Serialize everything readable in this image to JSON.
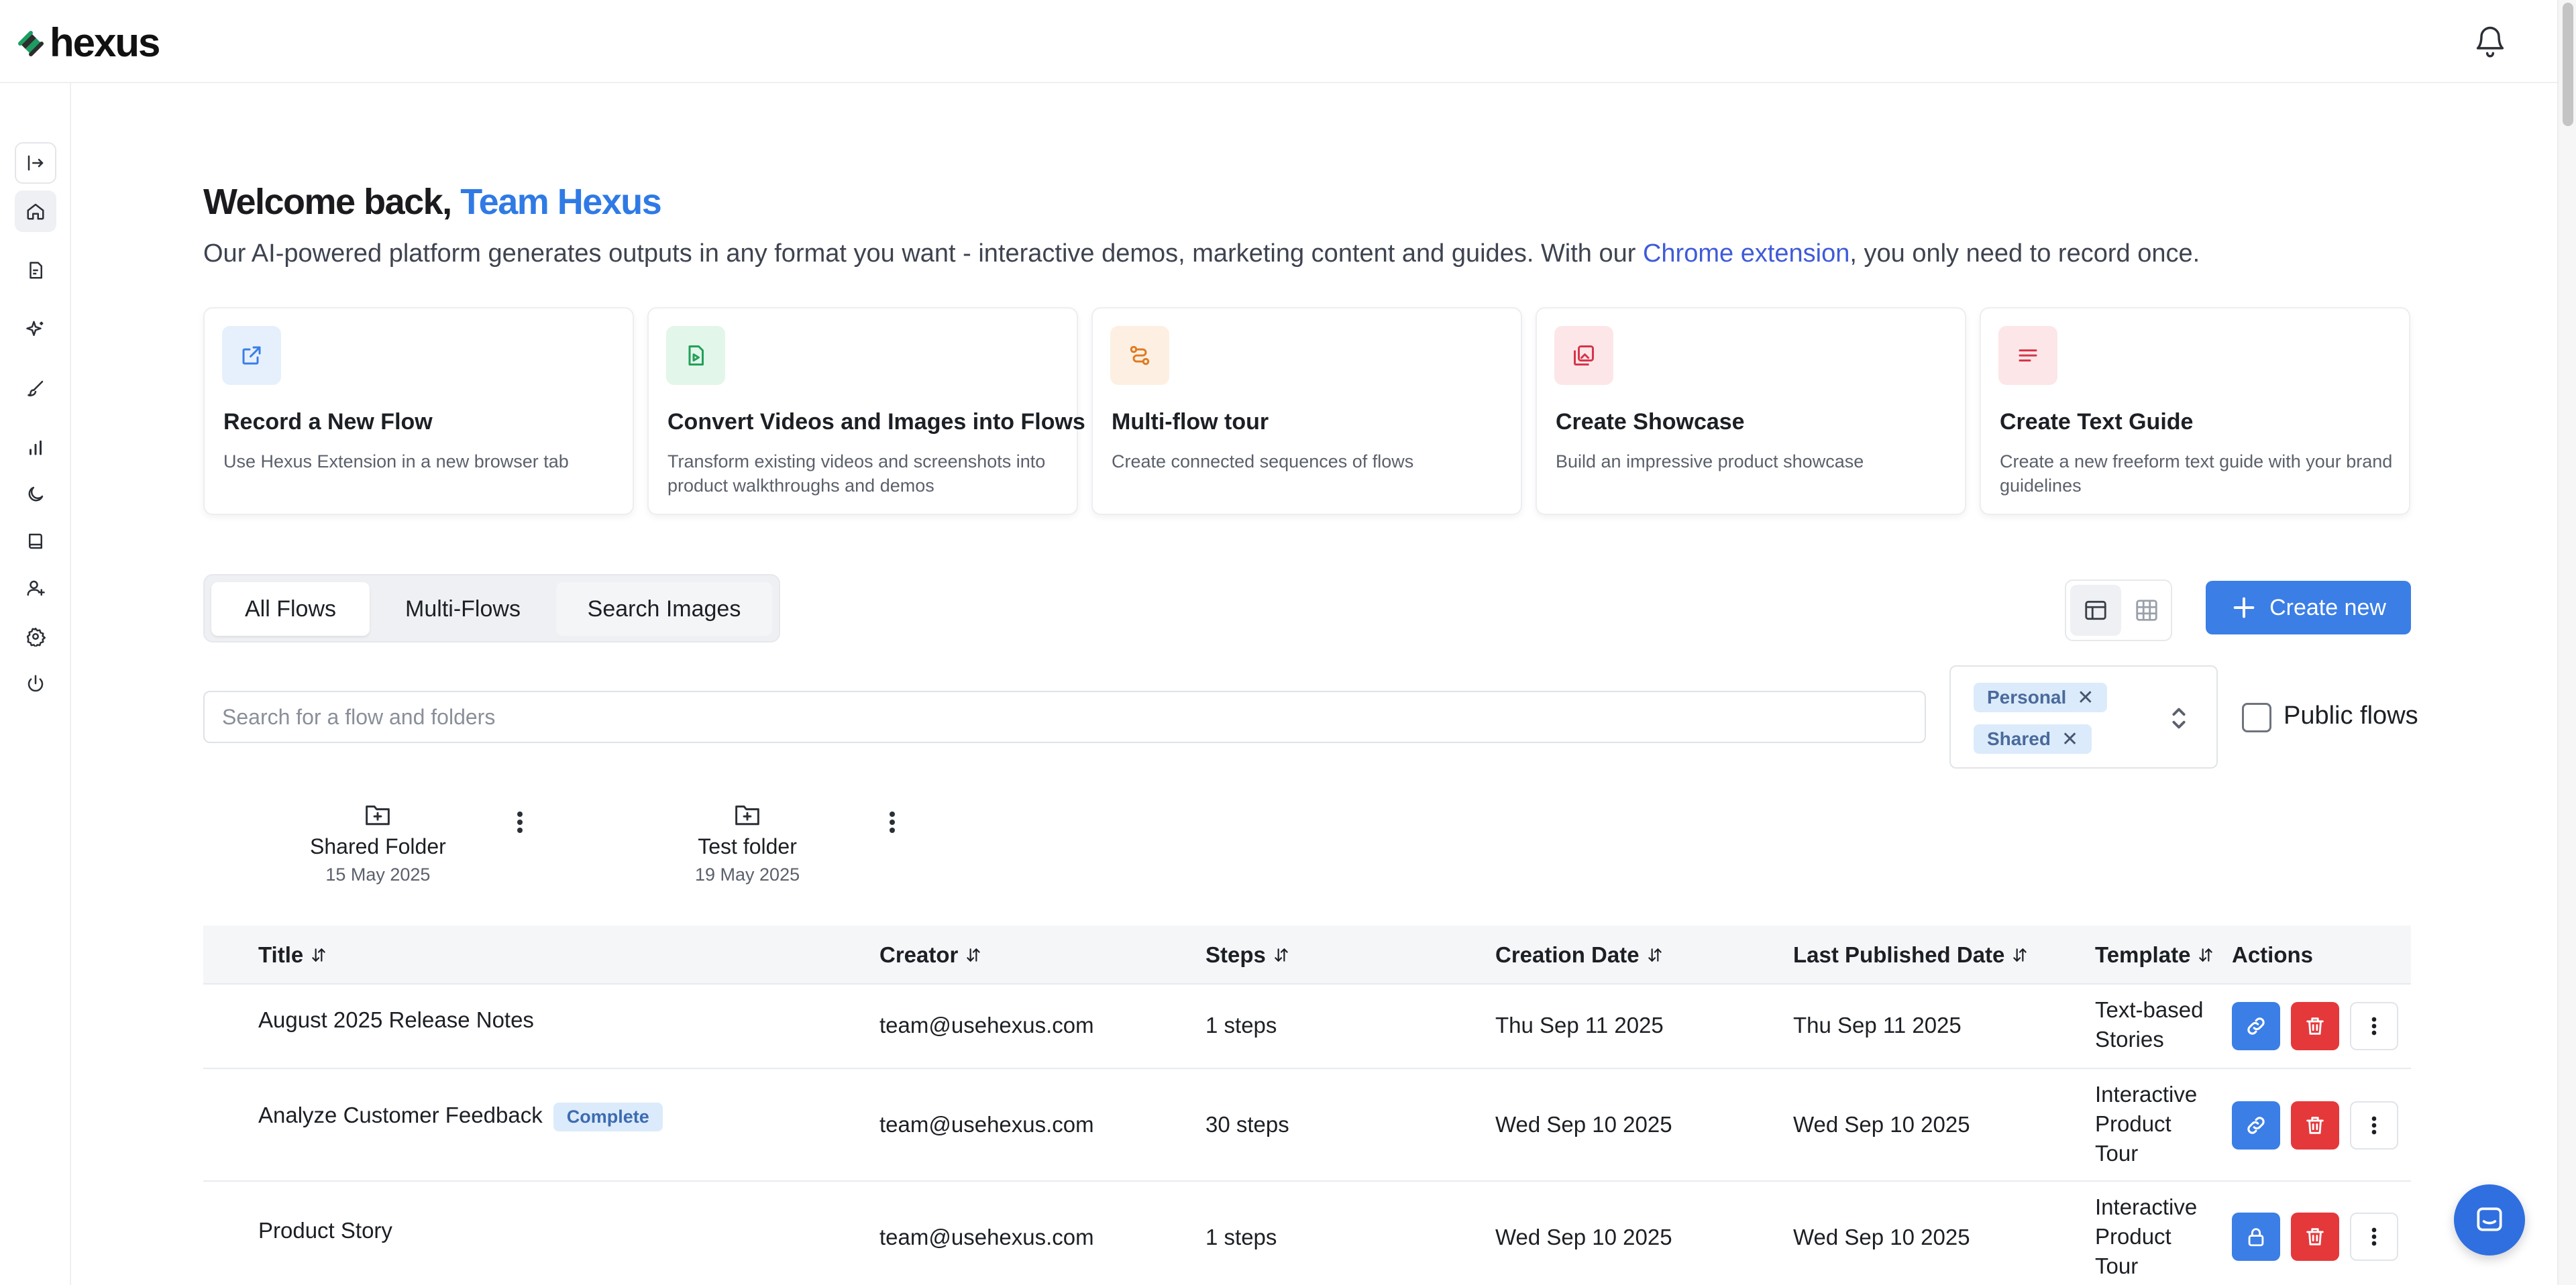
{
  "app": {
    "logo_text": "hexus"
  },
  "welcome": {
    "prefix": "Welcome back, ",
    "team": "Team Hexus",
    "subtitle_before": "Our AI-powered platform generates outputs in any format you want - interactive demos, marketing content and guides. With our ",
    "subtitle_link": "Chrome extension",
    "subtitle_after": ", you only need to record once."
  },
  "sidebar": {
    "items": [
      {
        "icon": "expand-sidebar-icon"
      },
      {
        "icon": "home-icon"
      },
      {
        "icon": "document-icon"
      },
      {
        "icon": "sparkle-icon"
      },
      {
        "icon": "brush-icon"
      },
      {
        "icon": "analytics-icon"
      },
      {
        "icon": "moon-icon"
      },
      {
        "icon": "book-icon"
      },
      {
        "icon": "add-user-icon"
      },
      {
        "icon": "settings-icon"
      },
      {
        "icon": "power-icon"
      }
    ]
  },
  "cards": [
    {
      "title": "Record a New Flow",
      "desc": "Use Hexus Extension in a new browser tab",
      "icon": "external-link-icon",
      "color": "#3b7ee6",
      "bg": "#e6f0fd"
    },
    {
      "title": "Convert Videos and Images into Flows",
      "desc": "Transform existing videos and screenshots into product walkthroughs and demos",
      "icon": "file-video-icon",
      "color": "#22a05a",
      "bg": "#e3f6ea"
    },
    {
      "title": "Multi-flow tour",
      "desc": "Create connected sequences of flows",
      "icon": "route-icon",
      "color": "#e07b24",
      "bg": "#fdf0e2"
    },
    {
      "title": "Create Showcase",
      "desc": "Build an impressive product showcase",
      "icon": "gallery-icon",
      "color": "#d6364a",
      "bg": "#fde6e8"
    },
    {
      "title": "Create Text Guide",
      "desc": "Create a new freeform text guide with your brand guidelines",
      "icon": "text-lines-icon",
      "color": "#d6364a",
      "bg": "#fde6e8"
    }
  ],
  "tabs": [
    "All Flows",
    "Multi-Flows",
    "Search Images"
  ],
  "toolbar": {
    "create_label": "Create new"
  },
  "search": {
    "placeholder": "Search for a flow and folders"
  },
  "filter": {
    "chips": [
      "Personal",
      "Shared"
    ]
  },
  "public_flows_label": "Public flows",
  "folders": [
    {
      "name": "Shared Folder",
      "date": "15 May 2025"
    },
    {
      "name": "Test folder",
      "date": "19 May 2025"
    }
  ],
  "table": {
    "headers": [
      "Title",
      "Creator",
      "Steps",
      "Creation Date",
      "Last Published Date",
      "Template",
      "Actions"
    ],
    "rows": [
      {
        "title": "August 2025 Release Notes",
        "badge": "",
        "creator": "team@usehexus.com",
        "steps": "1 steps",
        "created": "Thu Sep 11 2025",
        "published": "Thu Sep 11 2025",
        "template": "Text-based Stories",
        "first_action_icon": "link-icon"
      },
      {
        "title": "Analyze Customer Feedback",
        "badge": "Complete",
        "creator": "team@usehexus.com",
        "steps": "30 steps",
        "created": "Wed Sep 10 2025",
        "published": "Wed Sep 10 2025",
        "template": "Interactive Product Tour",
        "first_action_icon": "link-icon"
      },
      {
        "title": "Product Story",
        "badge": "",
        "creator": "team@usehexus.com",
        "steps": "1 steps",
        "created": "Wed Sep 10 2025",
        "published": "Wed Sep 10 2025",
        "template": "Interactive Product Tour",
        "first_action_icon": "lock-icon"
      }
    ]
  },
  "colors": {
    "accent": "#3b7ee6",
    "danger": "#e5383b",
    "link": "#3f5bd9"
  }
}
